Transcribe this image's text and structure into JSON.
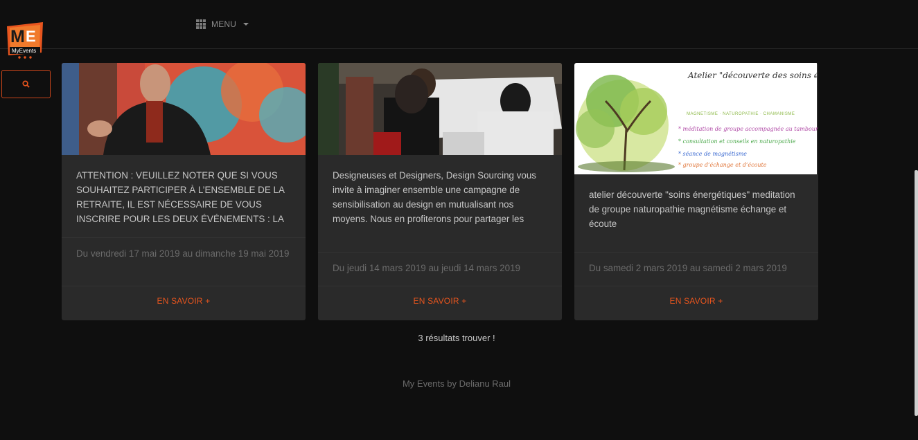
{
  "header": {
    "logo_text": "MyEvents",
    "menu_label": "MENU"
  },
  "search": {
    "icon": "search-icon"
  },
  "cards": [
    {
      "description": "ATTENTION : VEUILLEZ NOTER QUE SI VOUS SOUHAITEZ PARTICIPER À L’ENSEMBLE DE LA RETRAITE, IL EST NÉCESSAIRE DE VOUS INSCRIRE POUR LES DEUX ÉVÉNEMENTS : LA",
      "date": "Du vendredi 17 mai 2019 au dimanche 19 mai 2019",
      "link": "EN SAVOIR +"
    },
    {
      "description": "Designeuses et Designers, Design Sourcing vous invite à imaginer ensemble une campagne de sensibilisation au design en mutualisant nos moyens. Nous en profiterons pour partager les",
      "date": "Du jeudi 14 mars 2019 au jeudi 14 mars 2019",
      "link": "EN SAVOIR +"
    },
    {
      "description": "atelier découverte \"soins énergétiques\" meditation de groupe naturopathie magnétisme échange et écoute",
      "date": "Du samedi 2 mars 2019 au samedi 2 mars 2019",
      "link": "EN SAVOIR +",
      "image_text": {
        "title": "Atelier \"découverte des soins énergétiques\"",
        "subtitle": "MAGNETISME · NATUROPATHIE · CHAMANISME",
        "items": [
          "* méditation de groupe accompagnée au tambour",
          "* consultation et conseils en naturopathie",
          "* séance de magnétisme",
          "* groupe d’échange et d’écoute"
        ]
      }
    }
  ],
  "results_text": "3 résultats trouver !",
  "footer_text": "My Events by Delianu Raul",
  "colors": {
    "background": "#0f0f0f",
    "card": "#2a2a2a",
    "accent": "#e8551e"
  }
}
